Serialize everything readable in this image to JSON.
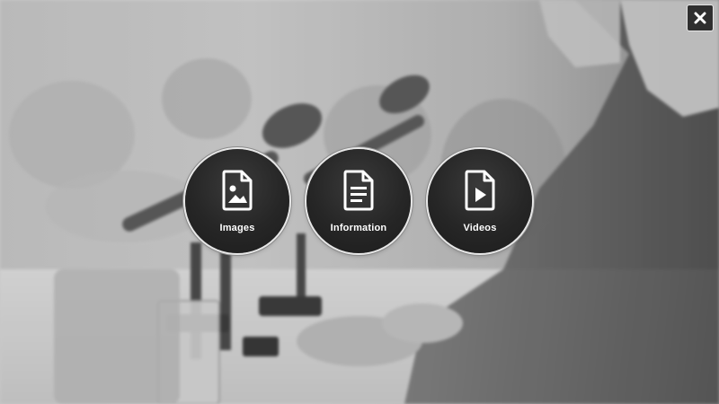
{
  "overlay": {
    "close_icon": "close-icon",
    "buttons": [
      {
        "label": "Images",
        "icon": "image-file-icon"
      },
      {
        "label": "Information",
        "icon": "document-text-icon"
      },
      {
        "label": "Videos",
        "icon": "video-file-icon"
      }
    ]
  },
  "colors": {
    "button_fill": "#262626",
    "button_ring": "#e8e8e8",
    "label": "#ffffff"
  }
}
